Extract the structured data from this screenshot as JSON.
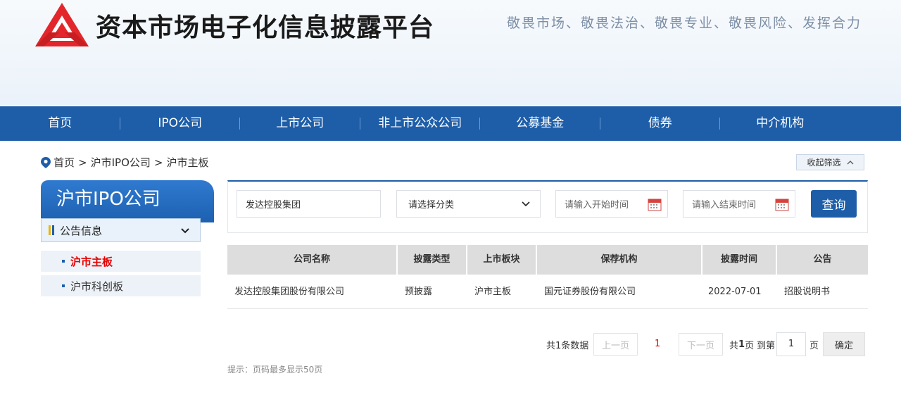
{
  "header": {
    "site_title": "资本市场电子化信息披露平台",
    "slogan": "敬畏市场、敬畏法治、敬畏专业、敬畏风险、发挥合力",
    "logo_color": "#e3262b"
  },
  "nav": {
    "items": [
      {
        "label": "首页"
      },
      {
        "label": "IPO公司"
      },
      {
        "label": "上市公司"
      },
      {
        "label": "非上市公众公司"
      },
      {
        "label": "公募基金"
      },
      {
        "label": "债券"
      },
      {
        "label": "中介机构"
      }
    ]
  },
  "breadcrumb": {
    "items": [
      "首页",
      "沪市IPO公司",
      "沪市主板"
    ],
    "separator": ">"
  },
  "collapse_filter_label": "收起筛选",
  "sidebar": {
    "title": "沪市IPO公司",
    "section_label": "公告信息",
    "items": [
      {
        "label": "沪市主板",
        "active": true
      },
      {
        "label": "沪市科创板",
        "active": false
      }
    ]
  },
  "filter": {
    "company_value": "发达控股集团",
    "category_placeholder": "请选择分类",
    "start_placeholder": "请输入开始时间",
    "end_placeholder": "请输入结束时间",
    "query_label": "查询"
  },
  "table": {
    "headers": [
      "公司名称",
      "披露类型",
      "上市板块",
      "保荐机构",
      "披露时间",
      "公告"
    ],
    "rows": [
      {
        "company": "发达控股集团股份有限公司",
        "type": "预披露",
        "board": "沪市主板",
        "sponsor": "国元证券股份有限公司",
        "date": "2022-07-01",
        "notice": "招股说明书"
      }
    ]
  },
  "pager": {
    "total_text": "共1条数据",
    "prev_label": "上一页",
    "current_page": "1",
    "next_label": "下一页",
    "total_pages_prefix": "共",
    "total_pages": "1",
    "total_pages_suffix": "页",
    "goto_label": "到第",
    "goto_value": "1",
    "page_unit": "页",
    "confirm_label": "确定"
  },
  "hint": "提示：页码最多显示50页",
  "colors": {
    "brand_blue": "#1e5ea8",
    "active_red": "#e60000"
  }
}
